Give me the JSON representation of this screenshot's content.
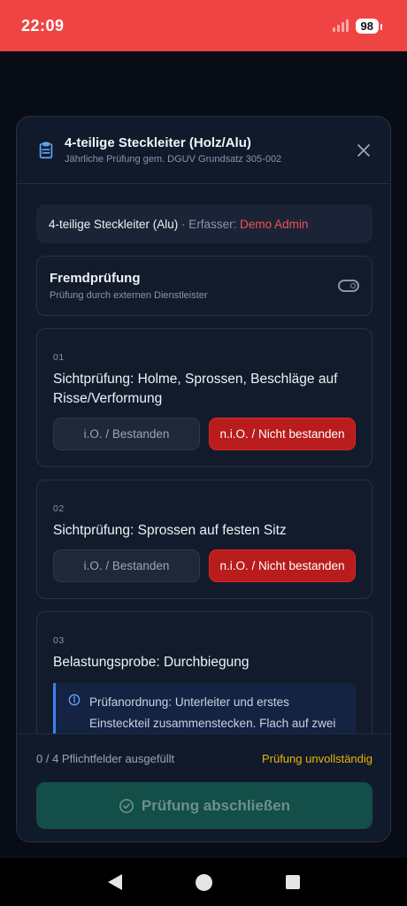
{
  "status_bar": {
    "time": "22:09",
    "battery": "98"
  },
  "modal": {
    "title": "4-teilige Steckleiter (Holz/Alu)",
    "subtitle": "Jährliche Prüfung gem. DGUV Grundsatz 305-002"
  },
  "info": {
    "object_name": "4-teilige Steckleiter (Alu)",
    "separator_label": " · Erfasser: ",
    "author": "Demo Admin"
  },
  "external": {
    "title": "Fremdprüfung",
    "subtitle": "Prüfung durch externen Dienstleister",
    "enabled": false
  },
  "items": [
    {
      "num": "01",
      "label": "Sichtprüfung: Holme, Sprossen, Beschläge auf Risse/Verformung",
      "ok_label": "i.O. / Bestanden",
      "nok_label": "n.i.O. / Nicht bestanden"
    },
    {
      "num": "02",
      "label": "Sichtprüfung: Sprossen auf festen Sitz",
      "ok_label": "i.O. / Bestanden",
      "nok_label": "n.i.O. / Nicht bestanden"
    },
    {
      "num": "03",
      "label": "Belastungsprobe: Durchbiegung",
      "notice": "Prüfanordnung: Unterleiter und erstes Einsteckteil zusammenstecken. Flach auf zwei Böcke legen (Unterstützungsabstand ="
    }
  ],
  "footer": {
    "progress": "0 / 4 Pflichtfelder ausgefüllt",
    "state": "Prüfung unvollständig",
    "submit_label": "Prüfung abschließen"
  },
  "colors": {
    "status_bar": "#ef4444",
    "accent_red": "#f05252",
    "fail_button": "#b91c1c",
    "warning": "#eab308",
    "submit_disabled": "#134e48",
    "info_border": "#3b82f6"
  },
  "icons": {
    "header": "clipboard-list-icon",
    "close": "close-icon",
    "toggle": "toggle-off-icon",
    "notice": "info-icon",
    "submit": "check-circle-icon"
  }
}
